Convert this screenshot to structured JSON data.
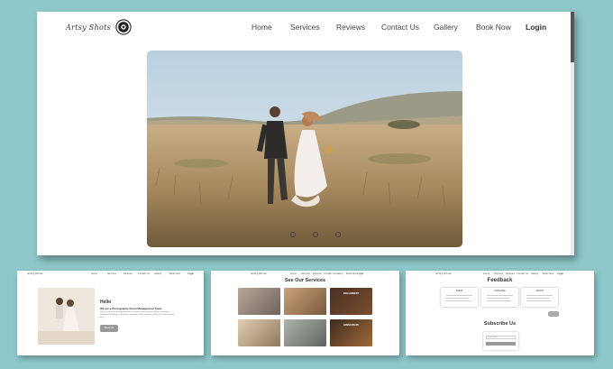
{
  "main": {
    "brand": "Artsy Shots",
    "nav": {
      "home": "Home",
      "services": "Services",
      "reviews": "Reviews",
      "contact": "Contact Us",
      "gallery": "Gallery",
      "book": "Book Now",
      "login": "Login"
    },
    "slider": {
      "slides": 3
    }
  },
  "about_preview": {
    "heading": "Hello",
    "subheading": "We are a Photography Event Management Team",
    "body": "We are a team of photographers that capture every moment of your celebration. Weddings, birthdays, ceremonies and more. We would love to be part of your special day.",
    "button": "Book Us"
  },
  "services_preview": {
    "title": "See Our Services",
    "tiles": [
      "",
      "",
      "ENGAGEMENT",
      "",
      "",
      "ANNIVERSARY"
    ]
  },
  "feedback_preview": {
    "title": "Feedback",
    "names": [
      "ANNA",
      "CATALINA",
      "JASON"
    ],
    "subscribe_title": "Subscribe Us",
    "email_placeholder": "Enter email"
  },
  "colors": {
    "background": "#8ec8cb",
    "nav_text": "#444444",
    "button": "#9a9a9a"
  }
}
